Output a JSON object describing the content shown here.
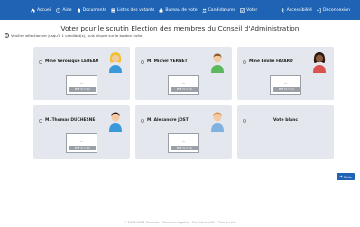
{
  "nav": {
    "left_items": [
      {
        "label": "Accueil",
        "icon": "home-icon"
      },
      {
        "label": "Aide",
        "icon": "help-circle-icon"
      },
      {
        "label": "Documents",
        "icon": "document-icon"
      },
      {
        "label": "Listes des votants",
        "icon": "list-icon"
      },
      {
        "label": "Bureau de vote",
        "icon": "ballot-box-icon"
      },
      {
        "label": "Candidatures",
        "icon": "candidates-icon"
      },
      {
        "label": "Voter",
        "icon": "vote-icon"
      }
    ],
    "right_items": [
      {
        "label": "Accessibilité",
        "icon": "accessibility-icon"
      },
      {
        "label": "Déconnexion",
        "icon": "logout-icon"
      }
    ]
  },
  "page": {
    "title": "Voter pour le scrutin Election des membres du Conseil d'Administration",
    "hint": "Veuillez sélectionner jusqu'à 1 candidat(s), puis cliquer sur le bouton Suite."
  },
  "candidates": [
    {
      "name": "Mme Veronique LEBEAU",
      "doc_dash": "...",
      "doc_label": "PDF (5.7 Ko)"
    },
    {
      "name": "M. Michel VERNET",
      "doc_dash": "...",
      "doc_label": "PDF (5.7 Ko)"
    },
    {
      "name": "Mme Emilie FAYARD",
      "doc_dash": "...",
      "doc_label": "PDF (5.7 Ko)"
    },
    {
      "name": "M. Thomas DUCHESNE",
      "doc_dash": "...",
      "doc_label": "PDF (5.7 Ko)"
    },
    {
      "name": "M. Alexandre JOST",
      "doc_dash": "...",
      "doc_label": "PDF (5.7 Ko)"
    },
    {
      "name": "Vote blanc"
    }
  ],
  "actions": {
    "next_label": "Suite"
  },
  "footer": {
    "text": "© 2007-2021 Neovote · Mentions légales · Confidentialité · Plan du site"
  },
  "colors": {
    "primary": "#1f64b4",
    "card": "#e4e8ee"
  }
}
